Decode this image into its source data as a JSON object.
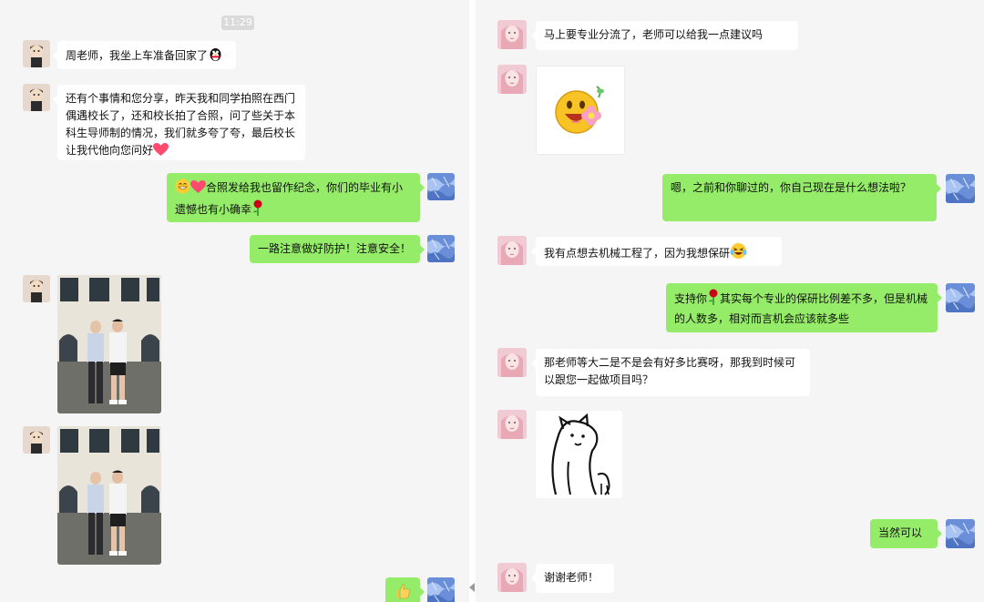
{
  "left": {
    "timestamp": "11:29",
    "messages": [
      {
        "text": "周老师，我坐上车准备回家了"
      },
      {
        "text": "还有个事情和您分享，昨天我和同学拍照在西门偶遇校长了，还和校长拍了合照，问了些关于本科生导师制的情况，我们就多夸了夸，最后校长让我代他向您问好"
      },
      {
        "text": "合照发给我也留作纪念，你们的毕业有小遗憾也有小确幸"
      },
      {
        "text": "一路注意做好防护！注意安全！"
      }
    ]
  },
  "right": {
    "messages": [
      {
        "text": "马上要专业分流了，老师可以给我一点建议吗"
      },
      {
        "text": "嗯，之前和你聊过的，你自己现在是什么想法啦？"
      },
      {
        "text": "我有点想去机械工程了，因为我想保研"
      },
      {
        "text": "支持你"
      },
      {
        "text": "其实每个专业的保研比例差不多，但是机械的人数多，相对而言机会应该就多些"
      },
      {
        "text": "那老师等大二是不是会有好多比赛呀，那我到时候可以跟您一起做项目吗？"
      },
      {
        "text": "当然可以"
      },
      {
        "text": "谢谢老师！"
      }
    ]
  },
  "colors": {
    "incoming_bubble": "#ffffff",
    "outgoing_bubble": "#95ec69",
    "chat_background": "#f5f5f5"
  },
  "icons": [
    "student-avatar-icon",
    "teacher-avatar-icon",
    "girl-avatar-icon",
    "penguin-emoji",
    "heart-emoji",
    "grin-emoji",
    "rose-emoji",
    "tear-laugh-emoji",
    "flower-smiley-sticker",
    "doodle-cat-sticker",
    "thumbs-up-emoji"
  ]
}
